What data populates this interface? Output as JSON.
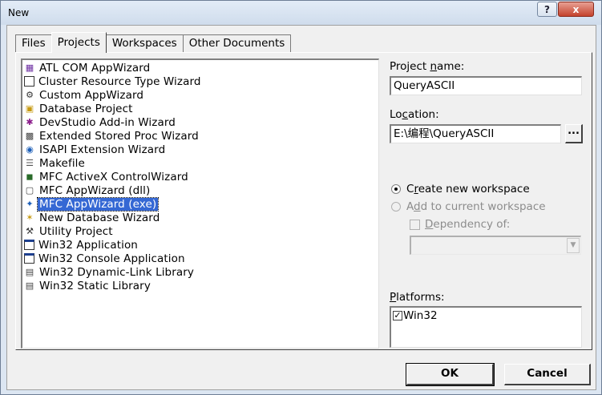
{
  "window": {
    "title": "New",
    "help_glyph": "?",
    "close_glyph": "x"
  },
  "tabs": [
    {
      "label": "Files",
      "active": false
    },
    {
      "label": "Projects",
      "active": true
    },
    {
      "label": "Workspaces",
      "active": false
    },
    {
      "label": "Other Documents",
      "active": false
    }
  ],
  "project_types": [
    {
      "label": "ATL COM AppWizard",
      "icon": "atl-wizard-icon",
      "selected": false
    },
    {
      "label": "Cluster Resource Type Wizard",
      "icon": "cluster-wizard-icon",
      "selected": false
    },
    {
      "label": "Custom AppWizard",
      "icon": "custom-wizard-icon",
      "selected": false
    },
    {
      "label": "Database Project",
      "icon": "database-icon",
      "selected": false
    },
    {
      "label": "DevStudio Add-in Wizard",
      "icon": "addin-wizard-icon",
      "selected": false
    },
    {
      "label": "Extended Stored Proc Wizard",
      "icon": "stored-proc-icon",
      "selected": false
    },
    {
      "label": "ISAPI Extension Wizard",
      "icon": "globe-icon",
      "selected": false
    },
    {
      "label": "Makefile",
      "icon": "makefile-icon",
      "selected": false
    },
    {
      "label": "MFC ActiveX ControlWizard",
      "icon": "activex-icon",
      "selected": false
    },
    {
      "label": "MFC AppWizard (dll)",
      "icon": "mfc-dll-icon",
      "selected": false
    },
    {
      "label": "MFC AppWizard (exe)",
      "icon": "mfc-exe-icon",
      "selected": true
    },
    {
      "label": "New Database Wizard",
      "icon": "new-database-icon",
      "selected": false
    },
    {
      "label": "Utility Project",
      "icon": "utility-icon",
      "selected": false
    },
    {
      "label": "Win32 Application",
      "icon": "win32-app-icon",
      "selected": false
    },
    {
      "label": "Win32 Console Application",
      "icon": "console-icon",
      "selected": false
    },
    {
      "label": "Win32 Dynamic-Link Library",
      "icon": "dll-icon",
      "selected": false
    },
    {
      "label": "Win32 Static Library",
      "icon": "static-lib-icon",
      "selected": false
    }
  ],
  "project_name": {
    "label_pre": "Project ",
    "label_u": "n",
    "label_post": "ame:",
    "value": "QueryASCII"
  },
  "location": {
    "label_pre": "Lo",
    "label_u": "c",
    "label_post": "ation:",
    "value": "E:\\编程\\QueryASCII",
    "browse_label": "..."
  },
  "workspace": {
    "create_new_pre": "C",
    "create_new_u": "r",
    "create_new_post": "eate new workspace",
    "create_new_selected": true,
    "add_current_pre": "A",
    "add_current_u": "d",
    "add_current_post": "d to current workspace",
    "add_current_enabled": false,
    "dependency_pre": "",
    "dependency_u": "D",
    "dependency_post": "ependency of:",
    "dependency_enabled": false,
    "dependency_value": ""
  },
  "platforms": {
    "label_pre": "",
    "label_u": "P",
    "label_post": "latforms:",
    "items": [
      {
        "label": "Win32",
        "checked": true
      }
    ]
  },
  "buttons": {
    "ok": "OK",
    "cancel": "Cancel"
  },
  "colors": {
    "selection": "#3568d4",
    "face": "#f0f0f0",
    "close": "#c4432d"
  }
}
